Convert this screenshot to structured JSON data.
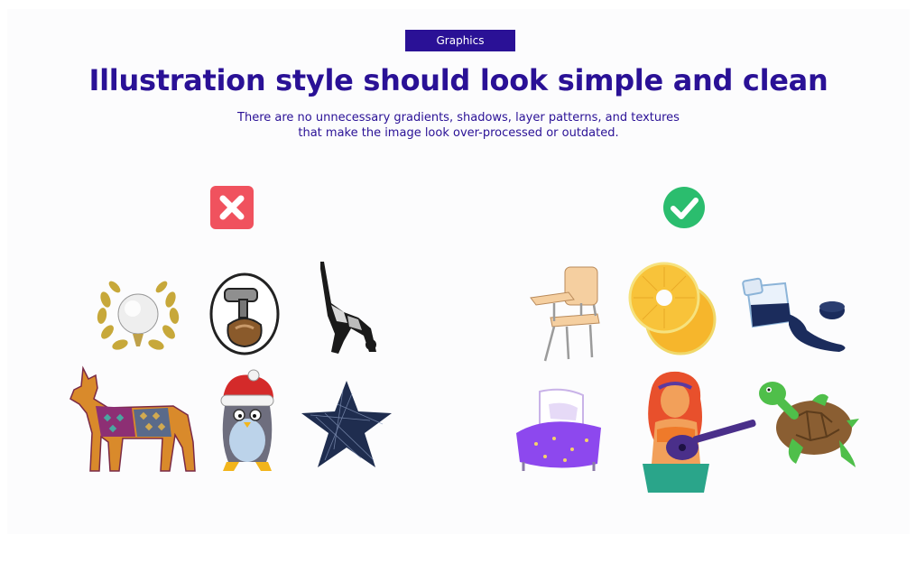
{
  "header": {
    "badge_label": "Graphics",
    "title": "Illustration style should look simple and clean",
    "subtitle": "There are no unnecessary gradients, shadows, layer patterns, and textures that make the image look over-processed or outdated."
  },
  "bad_examples": {
    "marker_icon": "x-icon",
    "marker_color": "#f0525e",
    "items": [
      "golf-ball-laurel-icon",
      "hammer-sack-sticker-icon",
      "yoga-silhouette-icon",
      "patterned-dog-icon",
      "penguin-santa-hat-icon",
      "scribble-star-icon"
    ]
  },
  "good_examples": {
    "marker_icon": "check-icon",
    "marker_color": "#2bbd6e",
    "items": [
      "school-desk-icon",
      "pineapple-rings-icon",
      "spilled-ink-jar-icon",
      "purple-bed-icon",
      "ukulele-woman-icon",
      "sea-turtle-icon"
    ]
  },
  "colors": {
    "brand": "#2a1196"
  }
}
